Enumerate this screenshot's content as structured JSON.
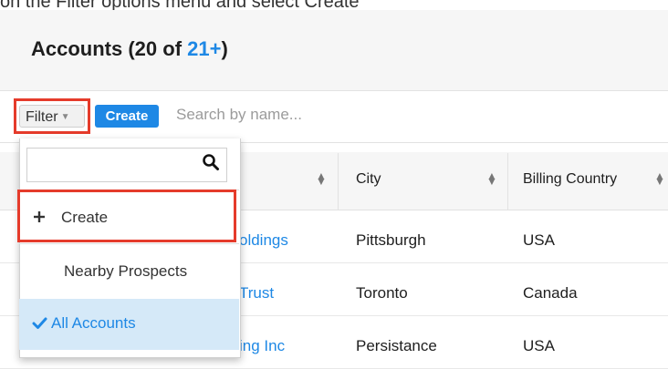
{
  "header": {
    "cut_text": "on the Filter options menu and select Create",
    "title_main": "Accounts (20 of ",
    "title_count": "21+",
    "title_close": ")"
  },
  "toolbar": {
    "filter_label": "Filter",
    "create_label": "Create",
    "search_placeholder": "Search by name..."
  },
  "table": {
    "columns": [
      "City",
      "Billing Country"
    ],
    "rows": [
      {
        "name_fragment": "oldings",
        "city": "Pittsburgh",
        "country": "USA"
      },
      {
        "name_fragment": "Trust",
        "city": "Toronto",
        "country": "Canada"
      },
      {
        "name_fragment": "ing Inc",
        "city": "Persistance",
        "country": "USA"
      }
    ]
  },
  "dropdown": {
    "create_label": "Create",
    "create_icon": "plus-icon",
    "items": [
      "Nearby Prospects",
      "All Accounts"
    ],
    "selected": "All Accounts",
    "selected_icon": "check-icon"
  },
  "colors": {
    "accent": "#1e88e5",
    "highlight_box": "#e53b2b",
    "selected_bg": "#d5e9f8"
  }
}
